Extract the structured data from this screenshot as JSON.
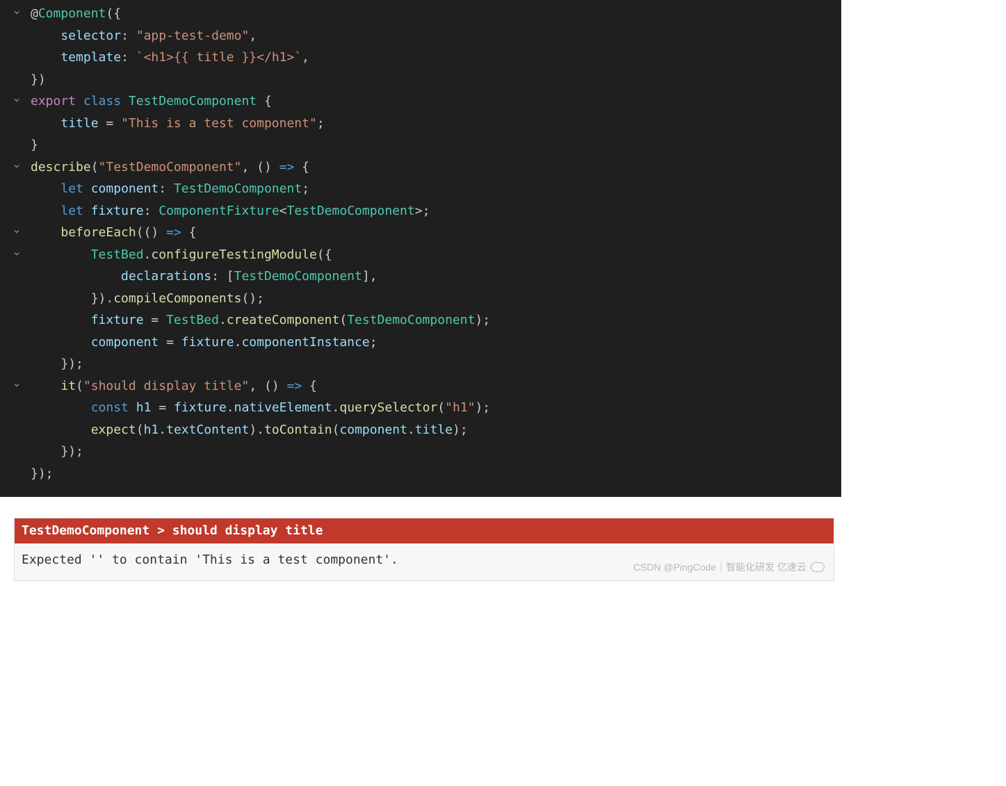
{
  "code": {
    "lines": [
      {
        "chev": true,
        "tokens": [
          [
            "tk-plain",
            "@"
          ],
          [
            "tk-type",
            "Component"
          ],
          [
            "tk-punc",
            "({"
          ]
        ]
      },
      {
        "chev": false,
        "indent": 2,
        "tokens": [
          [
            "tk-prop",
            "selector"
          ],
          [
            "tk-punc",
            ": "
          ],
          [
            "tk-string",
            "\"app-test-demo\""
          ],
          [
            "tk-punc",
            ","
          ]
        ]
      },
      {
        "chev": false,
        "indent": 2,
        "tokens": [
          [
            "tk-prop",
            "template"
          ],
          [
            "tk-punc",
            ": "
          ],
          [
            "tk-string",
            "`<h1>{{ title }}</h1>`"
          ],
          [
            "tk-punc",
            ","
          ]
        ]
      },
      {
        "chev": false,
        "tokens": [
          [
            "tk-punc",
            "})"
          ]
        ]
      },
      {
        "chev": true,
        "tokens": [
          [
            "tk-keyword",
            "export"
          ],
          [
            "tk-plain",
            " "
          ],
          [
            "tk-keyword2",
            "class"
          ],
          [
            "tk-plain",
            " "
          ],
          [
            "tk-type",
            "TestDemoComponent"
          ],
          [
            "tk-plain",
            " "
          ],
          [
            "tk-punc",
            "{"
          ]
        ]
      },
      {
        "chev": false,
        "indent": 2,
        "tokens": [
          [
            "tk-var",
            "title"
          ],
          [
            "tk-plain",
            " = "
          ],
          [
            "tk-string",
            "\"This is a test component\""
          ],
          [
            "tk-punc",
            ";"
          ]
        ]
      },
      {
        "chev": false,
        "tokens": [
          [
            "tk-punc",
            "}"
          ]
        ]
      },
      {
        "chev": false,
        "hl": true,
        "tokens": []
      },
      {
        "chev": true,
        "tokens": [
          [
            "tk-func",
            "describe"
          ],
          [
            "tk-punc",
            "("
          ],
          [
            "tk-string",
            "\"TestDemoComponent\""
          ],
          [
            "tk-punc",
            ", () "
          ],
          [
            "tk-keyword2",
            "=>"
          ],
          [
            "tk-punc",
            " {"
          ]
        ]
      },
      {
        "chev": false,
        "indent": 2,
        "tokens": [
          [
            "tk-keyword2",
            "let"
          ],
          [
            "tk-plain",
            " "
          ],
          [
            "tk-var",
            "component"
          ],
          [
            "tk-punc",
            ": "
          ],
          [
            "tk-type",
            "TestDemoComponent"
          ],
          [
            "tk-punc",
            ";"
          ]
        ]
      },
      {
        "chev": false,
        "indent": 2,
        "tokens": [
          [
            "tk-keyword2",
            "let"
          ],
          [
            "tk-plain",
            " "
          ],
          [
            "tk-var",
            "fixture"
          ],
          [
            "tk-punc",
            ": "
          ],
          [
            "tk-type",
            "ComponentFixture"
          ],
          [
            "tk-punc",
            "<"
          ],
          [
            "tk-type",
            "TestDemoComponent"
          ],
          [
            "tk-punc",
            ">;"
          ]
        ]
      },
      {
        "chev": false,
        "tokens": []
      },
      {
        "chev": true,
        "indent": 2,
        "tokens": [
          [
            "tk-func",
            "beforeEach"
          ],
          [
            "tk-punc",
            "(() "
          ],
          [
            "tk-keyword2",
            "=>"
          ],
          [
            "tk-punc",
            " {"
          ]
        ]
      },
      {
        "chev": true,
        "indent": 4,
        "tokens": [
          [
            "tk-type",
            "TestBed"
          ],
          [
            "tk-punc",
            "."
          ],
          [
            "tk-func",
            "configureTestingModule"
          ],
          [
            "tk-punc",
            "({"
          ]
        ]
      },
      {
        "chev": false,
        "indent": 6,
        "tokens": [
          [
            "tk-prop",
            "declarations"
          ],
          [
            "tk-punc",
            ": ["
          ],
          [
            "tk-type",
            "TestDemoComponent"
          ],
          [
            "tk-punc",
            "],"
          ]
        ]
      },
      {
        "chev": false,
        "indent": 4,
        "tokens": [
          [
            "tk-punc",
            "})."
          ],
          [
            "tk-func",
            "compileComponents"
          ],
          [
            "tk-punc",
            "();"
          ]
        ]
      },
      {
        "chev": false,
        "indent": 4,
        "tokens": [
          [
            "tk-var",
            "fixture"
          ],
          [
            "tk-plain",
            " = "
          ],
          [
            "tk-type",
            "TestBed"
          ],
          [
            "tk-punc",
            "."
          ],
          [
            "tk-func",
            "createComponent"
          ],
          [
            "tk-punc",
            "("
          ],
          [
            "tk-type",
            "TestDemoComponent"
          ],
          [
            "tk-punc",
            ");"
          ]
        ]
      },
      {
        "chev": false,
        "indent": 4,
        "tokens": [
          [
            "tk-var",
            "component"
          ],
          [
            "tk-plain",
            " = "
          ],
          [
            "tk-var",
            "fixture"
          ],
          [
            "tk-punc",
            "."
          ],
          [
            "tk-var",
            "componentInstance"
          ],
          [
            "tk-punc",
            ";"
          ]
        ]
      },
      {
        "chev": false,
        "indent": 2,
        "tokens": [
          [
            "tk-punc",
            "});"
          ]
        ]
      },
      {
        "chev": false,
        "tokens": []
      },
      {
        "chev": true,
        "indent": 2,
        "tokens": [
          [
            "tk-func",
            "it"
          ],
          [
            "tk-punc",
            "("
          ],
          [
            "tk-string",
            "\"should display title\""
          ],
          [
            "tk-punc",
            ", () "
          ],
          [
            "tk-keyword2",
            "=>"
          ],
          [
            "tk-punc",
            " {"
          ]
        ]
      },
      {
        "chev": false,
        "indent": 4,
        "tokens": [
          [
            "tk-keyword2",
            "const"
          ],
          [
            "tk-plain",
            " "
          ],
          [
            "tk-var",
            "h1"
          ],
          [
            "tk-plain",
            " = "
          ],
          [
            "tk-var",
            "fixture"
          ],
          [
            "tk-punc",
            "."
          ],
          [
            "tk-var",
            "nativeElement"
          ],
          [
            "tk-punc",
            "."
          ],
          [
            "tk-func",
            "querySelector"
          ],
          [
            "tk-punc",
            "("
          ],
          [
            "tk-string",
            "\"h1\""
          ],
          [
            "tk-punc",
            ");"
          ]
        ]
      },
      {
        "chev": false,
        "indent": 4,
        "tokens": [
          [
            "tk-func",
            "expect"
          ],
          [
            "tk-punc",
            "("
          ],
          [
            "tk-var",
            "h1"
          ],
          [
            "tk-punc",
            "."
          ],
          [
            "tk-var",
            "textContent"
          ],
          [
            "tk-punc",
            ")."
          ],
          [
            "tk-func",
            "toContain"
          ],
          [
            "tk-punc",
            "("
          ],
          [
            "tk-var",
            "component"
          ],
          [
            "tk-punc",
            "."
          ],
          [
            "tk-var",
            "title"
          ],
          [
            "tk-punc",
            ");"
          ]
        ]
      },
      {
        "chev": false,
        "indent": 2,
        "tokens": [
          [
            "tk-punc",
            "});"
          ]
        ]
      },
      {
        "chev": false,
        "tokens": [
          [
            "tk-punc",
            "});"
          ]
        ]
      }
    ]
  },
  "test_result": {
    "title": "TestDemoComponent > should display title",
    "body": "Expected '' to contain 'This is a test component'."
  },
  "watermark": "CSDN @PingCode｜智能化研发   亿速云"
}
